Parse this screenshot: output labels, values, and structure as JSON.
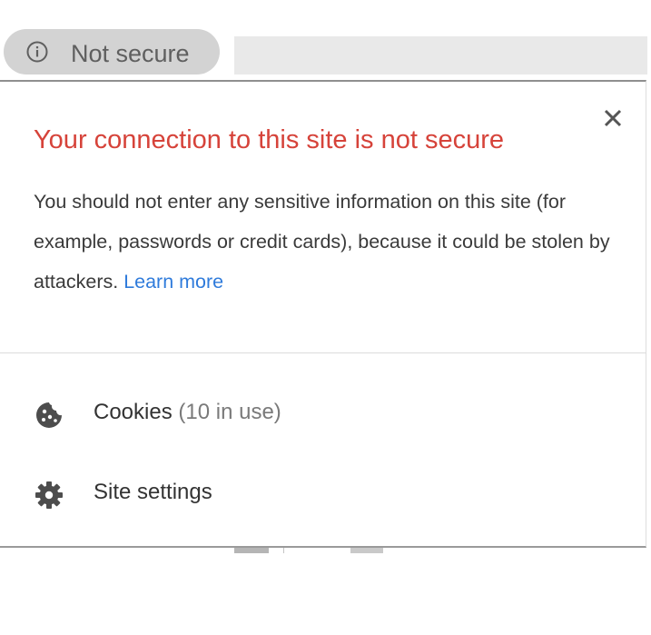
{
  "security_chip": {
    "icon": "info-circle-icon",
    "label": "Not secure"
  },
  "popup": {
    "title": "Your connection to this site is not secure",
    "body_text": "You should not enter any sensitive information on this site (for example, passwords or credit cards), because it could be stolen by attackers.",
    "learn_more": "Learn more",
    "close_icon": "close-icon"
  },
  "menu": {
    "cookies": {
      "icon": "cookie-icon",
      "label": "Cookies",
      "sub": "(10 in use)"
    },
    "site_settings": {
      "icon": "gear-icon",
      "label": "Site settings"
    }
  },
  "colors": {
    "title_red": "#d6433a",
    "link_blue": "#2f7bdb",
    "chip_bg": "#d3d3d3"
  }
}
